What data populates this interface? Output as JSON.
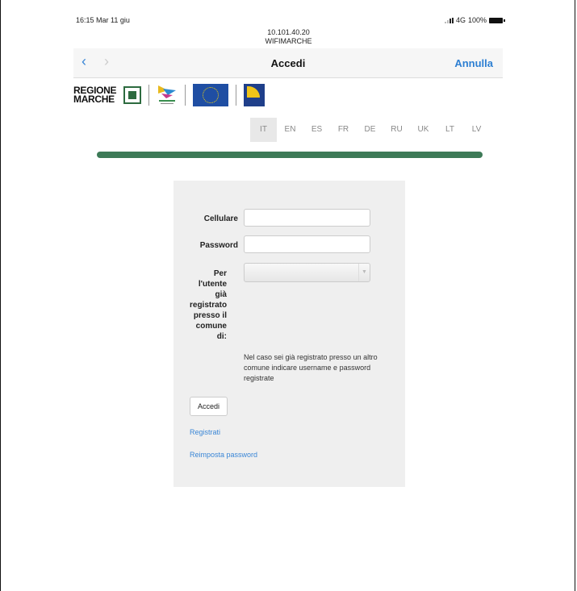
{
  "status_bar": {
    "time": "16:15  Mar 11 giu",
    "network": "4G",
    "battery": "100%"
  },
  "url": {
    "address": "10.101.40.20",
    "site": "WIFIMARCHE"
  },
  "nav": {
    "title": "Accedi",
    "cancel": "Annulla",
    "back_icon": "chevron-left-icon",
    "forward_icon": "chevron-right-icon"
  },
  "logos": {
    "region_line1": "REGIONE",
    "region_line2": "MARCHE"
  },
  "languages": [
    "IT",
    "EN",
    "ES",
    "FR",
    "DE",
    "RU",
    "UK",
    "LT",
    "LV"
  ],
  "form": {
    "phone_label": "Cellulare",
    "phone_value": "",
    "password_label": "Password",
    "password_value": "",
    "municipality_label_lines": [
      "Per",
      "l'utente",
      "già",
      "registrato",
      "presso il",
      "comune",
      "di:"
    ],
    "municipality_selected": "",
    "help_text": "Nel caso sei già registrato presso un altro comune indicare username e password registrate",
    "submit_label": "Accedi",
    "register_link": "Registrati",
    "reset_link": "Reimposta password"
  },
  "colors": {
    "accent": "#3a86d6",
    "progress": "#3d7a57",
    "card_bg": "#efefef"
  }
}
